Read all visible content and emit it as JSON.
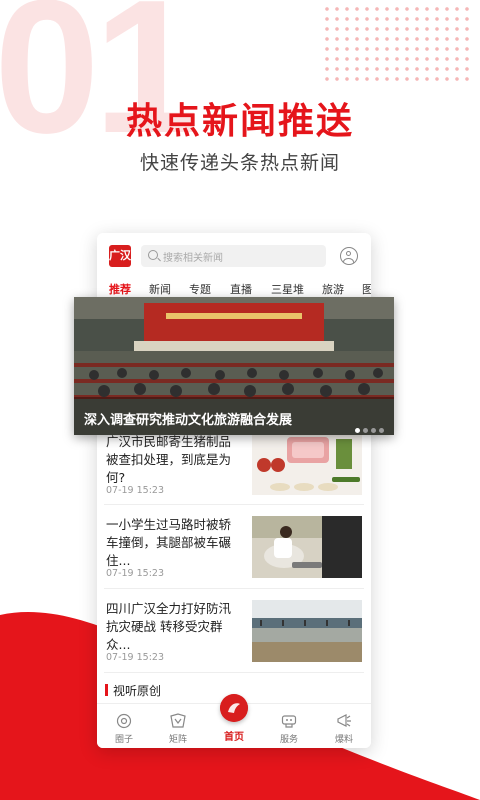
{
  "hero": {
    "number": "01",
    "title": "热点新闻推送",
    "subtitle": "快速传递头条热点新闻"
  },
  "app": {
    "logo_text": "广汉",
    "search_placeholder": "搜索相关新闻",
    "tabs": [
      "推荐",
      "新闻",
      "专题",
      "直播",
      "三星堆",
      "旅游",
      "图"
    ],
    "active_tab": "推荐"
  },
  "banner": {
    "title": "深入调查研究推动文化旅游融合发展",
    "dots": 4,
    "active_dot": 1
  },
  "news": [
    {
      "title": "广汉市民邮寄生猪制品被查扣处理，到底是为何?",
      "time": "07-19 15:23",
      "thumb": "meat-photo"
    },
    {
      "title": "一小学生过马路时被轿车撞倒，其腿部被车碾住...",
      "time": "07-19 15:23",
      "thumb": "street-photo"
    },
    {
      "title": "四川广汉全力打好防汛抗灾硬战 转移受灾群众...",
      "time": "07-19 15:23",
      "thumb": "flood-photo"
    }
  ],
  "section": {
    "label": "视听原创"
  },
  "bottom_nav": [
    {
      "label": "圈子",
      "icon": "circle-icon"
    },
    {
      "label": "矩阵",
      "icon": "matrix-icon"
    },
    {
      "label": "首页",
      "icon": "home-icon",
      "active": true
    },
    {
      "label": "服务",
      "icon": "service-icon"
    },
    {
      "label": "爆料",
      "icon": "report-icon"
    }
  ],
  "colors": {
    "accent": "#e5151b",
    "pale": "#fbe3e3"
  }
}
